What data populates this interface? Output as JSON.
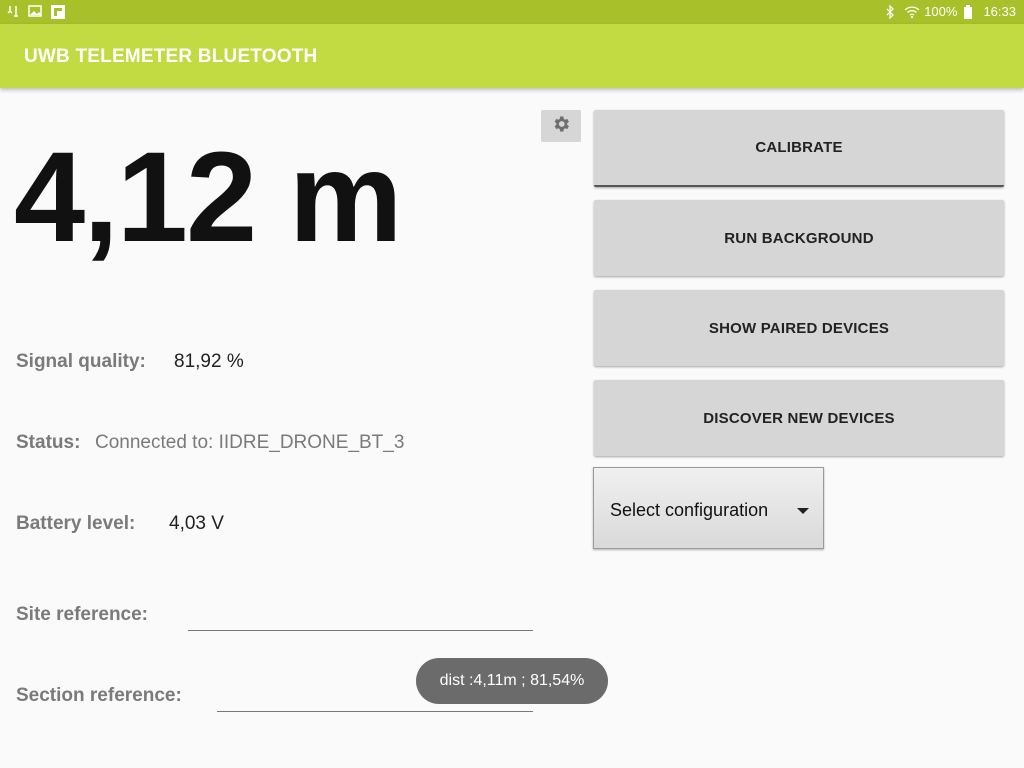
{
  "statusbar": {
    "left_icons": [
      "usb-debug-icon",
      "gallery-icon",
      "flipboard-icon"
    ],
    "bluetooth_icon": "bluetooth-icon",
    "wifi_icon": "wifi-icon",
    "battery_percent": "100%",
    "battery_icon": "battery-icon",
    "time": "16:33"
  },
  "appbar": {
    "title": "UWB TELEMETER BLUETOOTH"
  },
  "colors": {
    "statusbar": "#a8c12a",
    "appbar": "#c2db42",
    "button": "#d6d6d6",
    "toast": "#6b6b6b"
  },
  "main": {
    "distance": "4,12 m",
    "settings_icon": "gear-icon",
    "signal_label": "Signal quality:",
    "signal_value": "81,92 %",
    "status_label": "Status:",
    "status_value": "Connected to: IIDRE_DRONE_BT_3",
    "battery_label": "Battery level:",
    "battery_value": "4,03 V",
    "site_label": "Site reference:",
    "site_value": "",
    "section_label": "Section reference:",
    "section_value": ""
  },
  "buttons": {
    "calibrate": "CALIBRATE",
    "run_background": "RUN BACKGROUND",
    "show_paired": "SHOW PAIRED DEVICES",
    "discover": "DISCOVER NEW DEVICES"
  },
  "config_select": {
    "value": "Select configuration"
  },
  "toast": {
    "text": "dist :4,11m ; 81,54%"
  }
}
